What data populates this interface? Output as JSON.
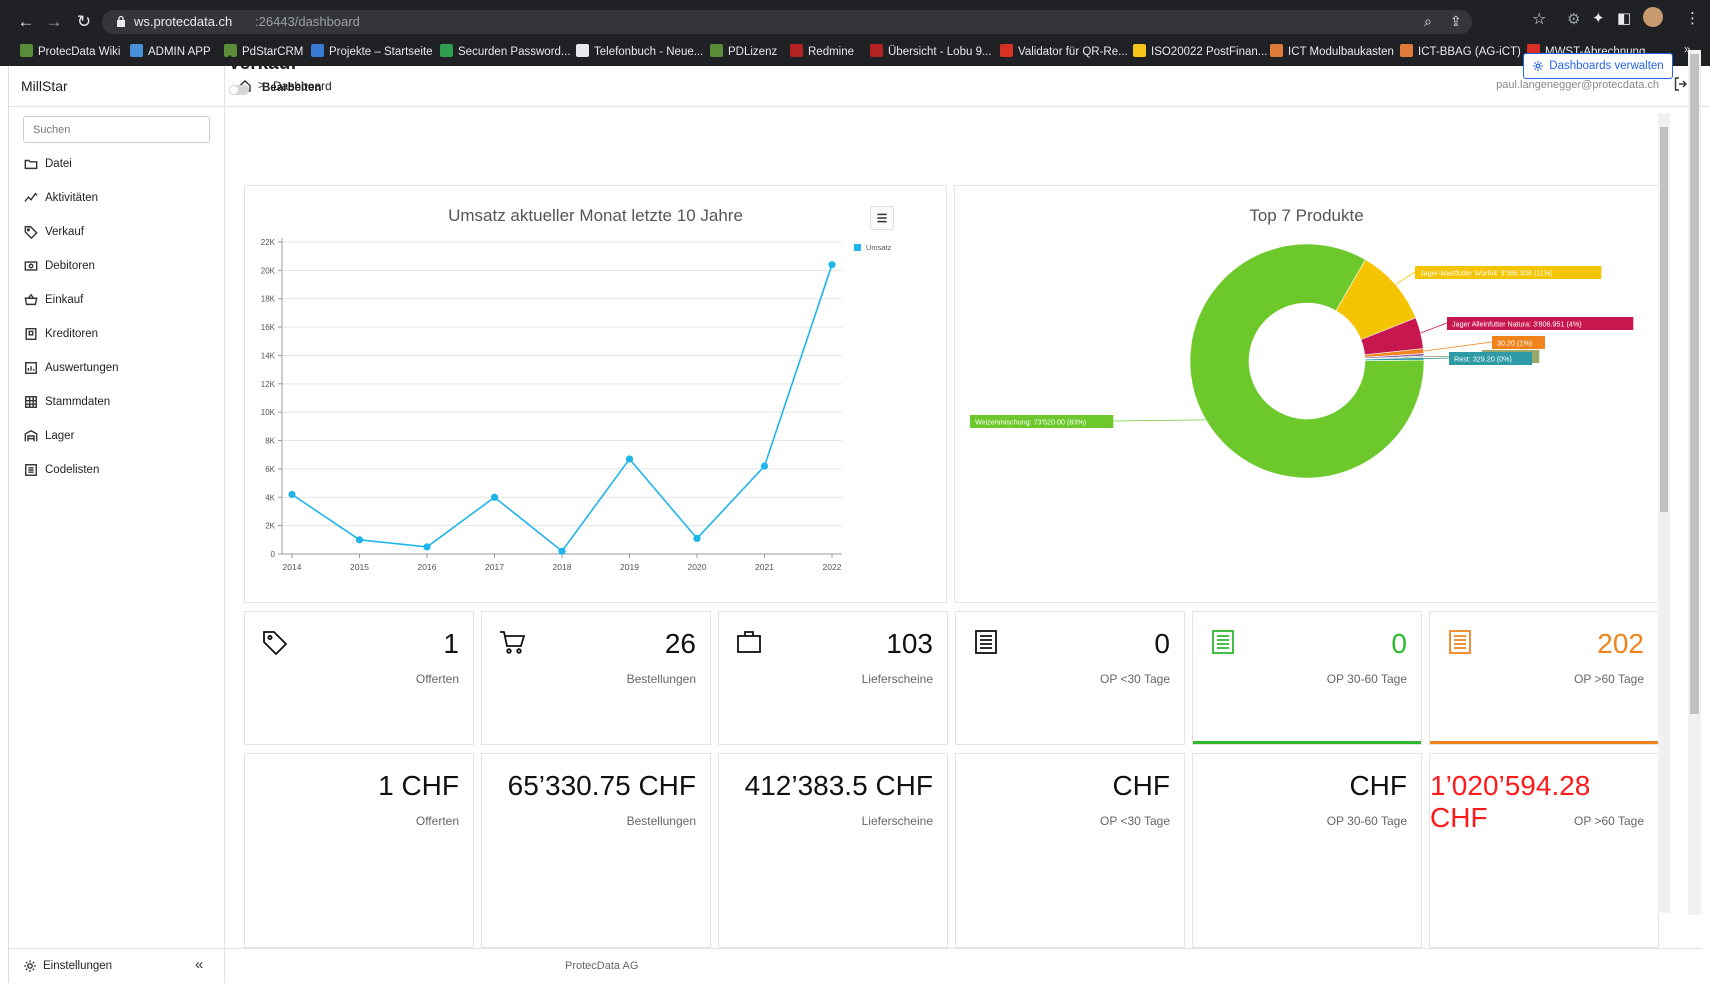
{
  "browser": {
    "url_host": "ws.protecdata.ch",
    "url_rest": ":26443/dashboard",
    "bookmarks": [
      {
        "label": "ProtecData Wiki",
        "color": "#5b8c3a"
      },
      {
        "label": "ADMIN APP",
        "color": "#4a90d9"
      },
      {
        "label": "PdStarCRM",
        "color": "#5b8c3a"
      },
      {
        "label": "Projekte – Startseite",
        "color": "#3a7bd5"
      },
      {
        "label": "Securden Password...",
        "color": "#2e9e4f"
      },
      {
        "label": "Telefonbuch - Neue...",
        "color": "#e8eaed"
      },
      {
        "label": "PDLizenz",
        "color": "#5b8c3a"
      },
      {
        "label": "Redmine",
        "color": "#b22222"
      },
      {
        "label": "Übersicht - Lobu 9...",
        "color": "#b22222"
      },
      {
        "label": "Validator für QR-Re...",
        "color": "#d93025"
      },
      {
        "label": "ISO20022 PostFinan...",
        "color": "#f5c518"
      },
      {
        "label": "ICT Modulbaukasten",
        "color": "#e07b39"
      },
      {
        "label": "ICT-BBAG (AG-iCT)",
        "color": "#e07b39"
      },
      {
        "label": "MWST-Abrechnung...",
        "color": "#d93025"
      }
    ],
    "more": "»"
  },
  "app": {
    "brand": "MillStar",
    "search_placeholder": "Suchen",
    "nav": [
      {
        "label": "Datei",
        "icon": "folder-icon"
      },
      {
        "label": "Aktivitäten",
        "icon": "activity-icon"
      },
      {
        "label": "Verkauf",
        "icon": "tag-icon"
      },
      {
        "label": "Debitoren",
        "icon": "money-icon"
      },
      {
        "label": "Einkauf",
        "icon": "basket-icon"
      },
      {
        "label": "Kreditoren",
        "icon": "receipt-icon"
      },
      {
        "label": "Auswertungen",
        "icon": "report-icon"
      },
      {
        "label": "Stammdaten",
        "icon": "grid-icon"
      },
      {
        "label": "Lager",
        "icon": "warehouse-icon"
      },
      {
        "label": "Codelisten",
        "icon": "list-icon"
      }
    ],
    "settings_label": "Einstellungen",
    "collapse": "«",
    "footer": "ProtecData AG"
  },
  "header": {
    "breadcrumb_sep": ">",
    "breadcrumb_page": "Dashboard",
    "user_email": "paul.langenegger@protecdata.ch"
  },
  "page": {
    "title": "Verkauf",
    "edit_label": "Bearbeiten",
    "manage_label": "Dashboards verwalten"
  },
  "chart_data": [
    {
      "type": "line",
      "title": "Umsatz aktueller Monat letzte 10 Jahre",
      "x": [
        "2014",
        "2015",
        "2016",
        "2017",
        "2018",
        "2019",
        "2020",
        "2021",
        "2022"
      ],
      "series": [
        {
          "name": "Umsatz",
          "values": [
            4200,
            1000,
            500,
            4000,
            200,
            6700,
            1100,
            6200,
            20400
          ]
        }
      ],
      "ylim": [
        0,
        22000
      ],
      "yticks": [
        "0",
        "2K",
        "4K",
        "6K",
        "8K",
        "10K",
        "12K",
        "14K",
        "16K",
        "18K",
        "20K",
        "22K"
      ],
      "legend": "top-right",
      "grid": true,
      "color": "#1fb5ea"
    },
    {
      "type": "pie",
      "title": "Top 7 Produkte",
      "slices": [
        {
          "label": "Weizenmischung: 73'520.00 (83%)",
          "value": 73520,
          "color": "#6cc82b"
        },
        {
          "label": "Jager-Mastfutter Würfeli: 9'386.938 (11%)",
          "value": 9386.938,
          "color": "#f5c400"
        },
        {
          "label": "Jager Alleinfutter Natura: 3'806.951 (4%)",
          "value": 3806.951,
          "color": "#c8174f"
        },
        {
          "label": "30.20 (1%)",
          "value": 600,
          "color": "#f0831c"
        },
        {
          "label": "",
          "value": 300,
          "color": "#8c6bb1"
        },
        {
          "label": "547.50 (0%)",
          "value": 147.5,
          "color": "#9aa86a"
        },
        {
          "label": "Rest: 329.20 (0%)",
          "value": 329.2,
          "color": "#2d9aa6"
        }
      ]
    }
  ],
  "stats_counts": [
    {
      "value": "1",
      "label": "Offerten",
      "icon": "tag-icon",
      "color": "#111",
      "bar": ""
    },
    {
      "value": "26",
      "label": "Bestellungen",
      "icon": "cart-icon",
      "color": "#111",
      "bar": ""
    },
    {
      "value": "103",
      "label": "Lieferscheine",
      "icon": "briefcase-icon",
      "color": "#111",
      "bar": ""
    },
    {
      "value": "0",
      "label": "OP <30 Tage",
      "icon": "document-icon",
      "color": "#111",
      "bar": ""
    },
    {
      "value": "0",
      "label": "OP 30-60 Tage",
      "icon": "document-icon",
      "color": "#2db82d",
      "bar": "#2db82d"
    },
    {
      "value": "202",
      "label": "OP >60 Tage",
      "icon": "document-icon",
      "color": "#f0831c",
      "bar": "#f0831c"
    }
  ],
  "stats_amounts": [
    {
      "value": "1 CHF",
      "label": "Offerten",
      "color": "#111"
    },
    {
      "value": "65’330.75 CHF",
      "label": "Bestellungen",
      "color": "#111"
    },
    {
      "value": "412’383.5 CHF",
      "label": "Lieferscheine",
      "color": "#111"
    },
    {
      "value": "CHF",
      "label": "OP <30 Tage",
      "color": "#111"
    },
    {
      "value": "CHF",
      "label": "OP 30-60 Tage",
      "color": "#111"
    },
    {
      "value": "1’020’594.28 CHF",
      "label": "OP >60 Tage",
      "color": "#ff1a1a"
    }
  ]
}
